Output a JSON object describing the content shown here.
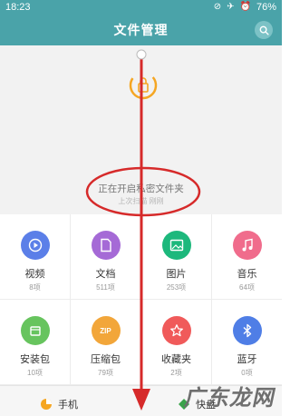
{
  "status": {
    "time": "18:23",
    "battery": "76%"
  },
  "header": {
    "title": "文件管理"
  },
  "secret": {
    "title": "正在开启私密文件夹",
    "sub": "上次扫描 刚刚"
  },
  "categories": [
    {
      "label": "视频",
      "count": "8项",
      "color": "#5b7fe8",
      "icon": "play-icon"
    },
    {
      "label": "文档",
      "count": "511项",
      "color": "#a56ad6",
      "icon": "document-icon"
    },
    {
      "label": "图片",
      "count": "253项",
      "color": "#1db87c",
      "icon": "image-icon"
    },
    {
      "label": "音乐",
      "count": "64项",
      "color": "#f06c8c",
      "icon": "music-icon"
    },
    {
      "label": "安装包",
      "count": "10项",
      "color": "#67c45e",
      "icon": "package-icon"
    },
    {
      "label": "压缩包",
      "count": "79项",
      "color": "#f2a63a",
      "icon": "zip-icon",
      "badge": "ZIP"
    },
    {
      "label": "收藏夹",
      "count": "2项",
      "color": "#f05a5a",
      "icon": "star-icon"
    },
    {
      "label": "蓝牙",
      "count": "0项",
      "color": "#4f7ee6",
      "icon": "bluetooth-icon"
    }
  ],
  "bottom": {
    "phone": "手机",
    "kuaipan": "快盘"
  },
  "watermark": "广东龙网"
}
